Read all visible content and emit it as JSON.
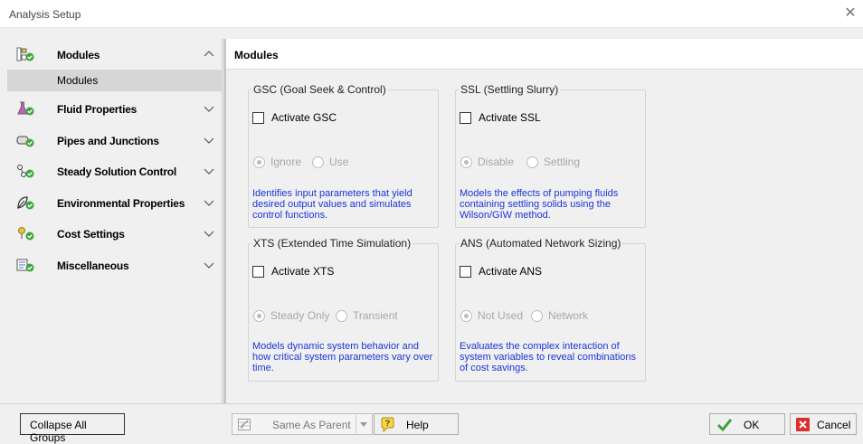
{
  "window": {
    "title": "Analysis Setup",
    "close_glyph": "✕"
  },
  "sidebar": {
    "groups": [
      {
        "label": "Modules",
        "icon": "modules-icon",
        "expanded": true,
        "items": [
          {
            "label": "Modules",
            "selected": true
          }
        ]
      },
      {
        "label": "Fluid Properties",
        "icon": "fluid-properties-icon",
        "expanded": false
      },
      {
        "label": "Pipes and Junctions",
        "icon": "pipes-icon",
        "expanded": false
      },
      {
        "label": "Steady Solution Control",
        "icon": "steady-solution-icon",
        "expanded": false
      },
      {
        "label": "Environmental Properties",
        "icon": "environmental-icon",
        "expanded": false
      },
      {
        "label": "Cost Settings",
        "icon": "cost-settings-icon",
        "expanded": false
      },
      {
        "label": "Miscellaneous",
        "icon": "miscellaneous-icon",
        "expanded": false
      }
    ]
  },
  "main": {
    "title": "Modules",
    "panels": {
      "gsc": {
        "legend": "GSC (Goal Seek & Control)",
        "checkbox_label": "Activate GSC",
        "checked": false,
        "radio1": "Ignore",
        "radio2": "Use",
        "selected": 1,
        "description": "Identifies input parameters that yield desired output values and simulates control functions."
      },
      "ssl": {
        "legend": "SSL (Settling Slurry)",
        "checkbox_label": "Activate SSL",
        "checked": false,
        "radio1": "Disable",
        "radio2": "Settling",
        "selected": 1,
        "description": "Models the effects of pumping fluids containing settling solids using the Wilson/GIW method."
      },
      "xts": {
        "legend": "XTS (Extended Time Simulation)",
        "checkbox_label": "Activate XTS",
        "checked": false,
        "radio1": "Steady Only",
        "radio2": "Transient",
        "selected": 1,
        "description": "Models dynamic system behavior and how critical system parameters vary over time."
      },
      "ans": {
        "legend": "ANS (Automated Network Sizing)",
        "checkbox_label": "Activate ANS",
        "checked": false,
        "radio1": "Not Used",
        "radio2": "Network",
        "selected": 1,
        "description": "Evaluates the complex interaction of system variables to reveal combinations of cost savings."
      }
    }
  },
  "footer": {
    "collapse_label": "Collapse All Groups",
    "same_as_parent_label": "Same As Parent",
    "help_label": "Help",
    "ok_label": "OK",
    "cancel_label": "Cancel"
  },
  "colors": {
    "accent_green": "#3fa33f",
    "description_blue": "#1a35d8",
    "cancel_red": "#d9302a"
  }
}
